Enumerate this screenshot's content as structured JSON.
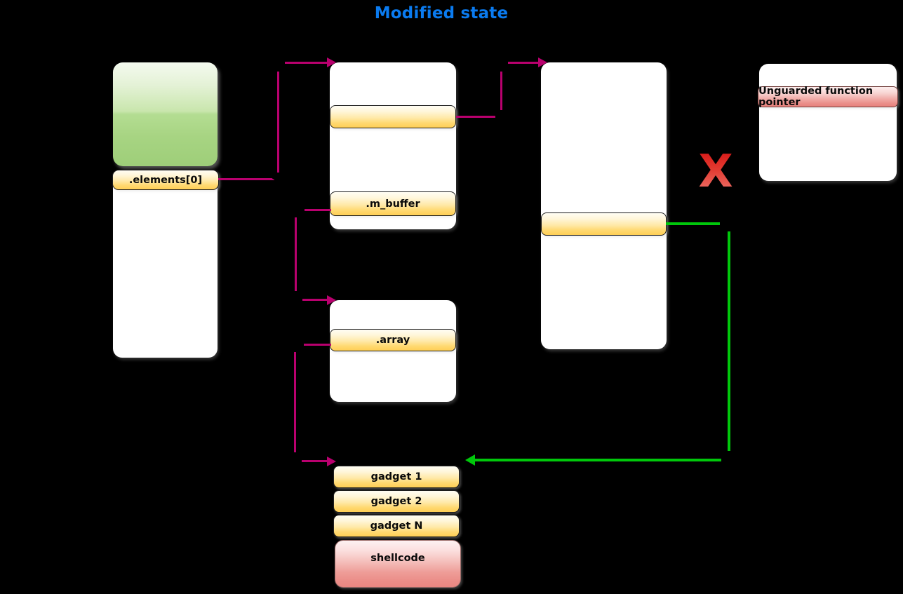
{
  "title": "Modified state",
  "colors": {
    "title": "#0a7bf0",
    "pink_arrow": "#b9006e",
    "green_arrow": "#00c70b",
    "red_x": "#e23b31",
    "orange_bar": "#ffd972",
    "red_bar": "#ea8d88",
    "green_block": "#a7d482",
    "background": "#000000"
  },
  "objects": {
    "elements_block": {
      "label": ".elements[0]",
      "green_region_name": "allocated-green-region"
    },
    "buffer_object": {
      "unnamed_bar": "",
      "buffer_label": ".m_buffer"
    },
    "target_object": {
      "unnamed_bar": ""
    },
    "array_object": {
      "label": ".array"
    },
    "function_pointer_object": {
      "label": "Unguarded function pointer"
    },
    "payload": {
      "items": [
        {
          "label": "gadget 1",
          "kind": "gadget"
        },
        {
          "label": "gadget 2",
          "kind": "gadget"
        },
        {
          "label": "gadget N",
          "kind": "gadget"
        },
        {
          "label": "shellcode",
          "kind": "shellcode"
        }
      ]
    },
    "blocked_marker": {
      "glyph": "X"
    }
  }
}
